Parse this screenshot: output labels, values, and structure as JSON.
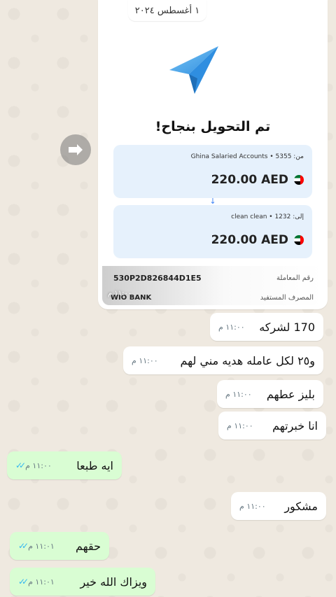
{
  "date_chip": "١ أغسطس ٢٠٢٤",
  "receipt": {
    "title": "تم التحويل بنجاح!",
    "from_label": "من: Ghina Salaried Accounts • 5355",
    "from_amount": "220.00 AED",
    "to_label": "إلى: clean clean • 1232",
    "to_amount": "220.00 AED",
    "arrow": "↓",
    "txn_label": "رقم المعاملة",
    "txn_value": "530P2D826844D1E5",
    "bank_label": "المصرف المستفيد",
    "bank_value": "WIO BANK",
    "time": "١١:٠٠ م"
  },
  "messages": [
    {
      "text": "170 لشركه",
      "time": "١١:٠٠ م",
      "direction": "in"
    },
    {
      "text": "و٢٥ لكل عامله هديه مني لهم",
      "time": "١١:٠٠ م",
      "direction": "in"
    },
    {
      "text": "بليز عطهم",
      "time": "١١:٠٠ م",
      "direction": "in"
    },
    {
      "text": "انا خبرتهم",
      "time": "١١:٠٠ م",
      "direction": "in"
    },
    {
      "text": "ايه طبعا",
      "time": "١١:٠٠ م",
      "direction": "out",
      "ticks": "✓✓"
    },
    {
      "text": "مشكور",
      "time": "١١:٠٠ م",
      "direction": "in"
    },
    {
      "text": "حقهم",
      "time": "١١:٠١ م",
      "direction": "out",
      "ticks": "✓✓"
    },
    {
      "text": "ويزاك الله خير",
      "time": "١١:٠١ م",
      "direction": "out",
      "ticks": "✓✓"
    }
  ],
  "colors": {
    "incoming": "#ffffff",
    "outgoing": "#d9fdd3",
    "read_ticks": "#34b7f1",
    "plane": "#3aa3e8"
  },
  "icons": {
    "forward": "forward-icon",
    "plane": "paper-plane-icon",
    "flag": "uae-flag-icon"
  }
}
